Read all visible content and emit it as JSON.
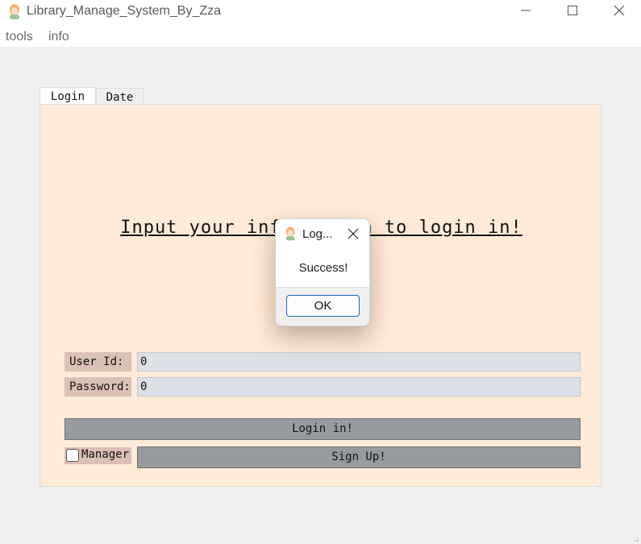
{
  "window": {
    "title": "Library_Manage_System_By_Zza",
    "icon": "app-avatar-icon",
    "controls": [
      "minimize-icon",
      "maximize-icon",
      "close-icon"
    ]
  },
  "menu": {
    "items": [
      {
        "label": "tools"
      },
      {
        "label": "info"
      }
    ]
  },
  "tabs": [
    {
      "label": "Login",
      "active": true
    },
    {
      "label": "Date",
      "active": false
    }
  ],
  "login": {
    "heading": "Input your information to login in!",
    "heading_visible": "Input your in",
    "heading_visible_tail": "to login in!",
    "user_id_label": "User Id:",
    "user_id_value": "0",
    "password_label": "Password:",
    "password_value": "0",
    "login_button": "Login in!",
    "manager_label": "Manager",
    "manager_checked": false,
    "signup_button": "Sign Up!"
  },
  "dialog": {
    "title": "Log...",
    "message": "Success!",
    "ok_label": "OK"
  },
  "colors": {
    "panel_bg": "#ffebd8",
    "label_bg": "#dcc0b4",
    "input_bg": "#dde1e7",
    "button_bg": "#979ba0",
    "dialog_accent": "#1a66c4"
  }
}
